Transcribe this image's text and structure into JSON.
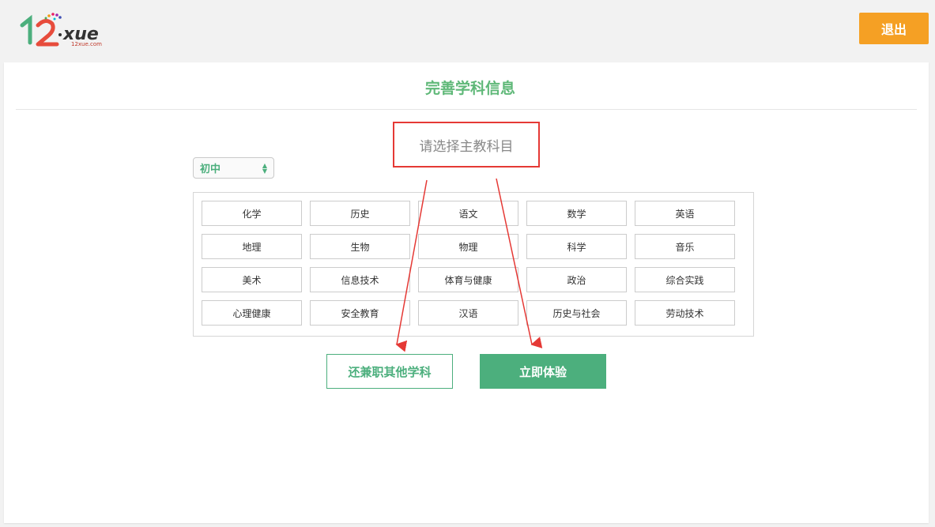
{
  "header": {
    "logo_text": "12xue",
    "logo_sub": "12xue.com",
    "logout_label": "退出"
  },
  "page": {
    "title": "完善学科信息",
    "prompt": "请选择主教科目",
    "level_select": "初中"
  },
  "subjects": [
    [
      "化学",
      "历史",
      "语文",
      "数学",
      "英语"
    ],
    [
      "地理",
      "生物",
      "物理",
      "科学",
      "音乐"
    ],
    [
      "美术",
      "信息技术",
      "体育与健康",
      "政治",
      "综合实践"
    ],
    [
      "心理健康",
      "安全教育",
      "汉语",
      "历史与社会",
      "劳动技术"
    ]
  ],
  "actions": {
    "other_label": "还兼职其他学科",
    "go_label": "立即体验"
  },
  "colors": {
    "accent_green": "#4caf7d",
    "logout_orange": "#f5a024",
    "annotation_red": "#e53935"
  }
}
